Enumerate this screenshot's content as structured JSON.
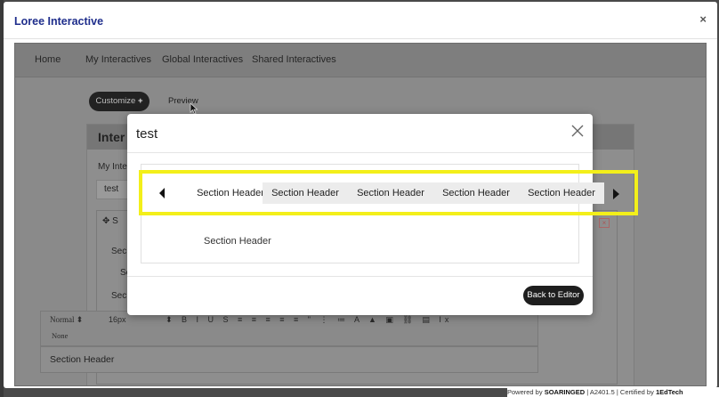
{
  "outer_modal": {
    "title": "Loree Interactive",
    "close_glyph": "×"
  },
  "nav": {
    "items": [
      "Home",
      "My Interactives",
      "Global Interactives",
      "Shared Interactives"
    ]
  },
  "background": {
    "customize_label": "Customize",
    "customize_icon": "plus-icon",
    "preview_label": "Preview",
    "panel_title": "Inter",
    "my_interactive_label": "My Inter",
    "input_value": "test",
    "section_label_1": "Sec",
    "section_label_2": "Se",
    "section_label_3": "Sec",
    "toolbar_font": "Normal",
    "toolbar_size": "16px",
    "toolbar_none": "None",
    "editor_text": "Section Header"
  },
  "preview_modal": {
    "title": "test",
    "tabs": [
      {
        "label": "Section Header",
        "active": true
      },
      {
        "label": "Section Header",
        "active": false
      },
      {
        "label": "Section Header",
        "active": false
      },
      {
        "label": "Section Header",
        "active": false
      },
      {
        "label": "Section Header",
        "active": false
      }
    ],
    "panel_content": "Section Header",
    "back_button_label": "Back to Editor"
  },
  "highlight_color": "#f3ef1a",
  "footer": {
    "powered_by": "Powered by",
    "brand": "SOARINGED",
    "version": "A2401.5",
    "certified": "Certified by",
    "certifier": "1EdTech"
  }
}
